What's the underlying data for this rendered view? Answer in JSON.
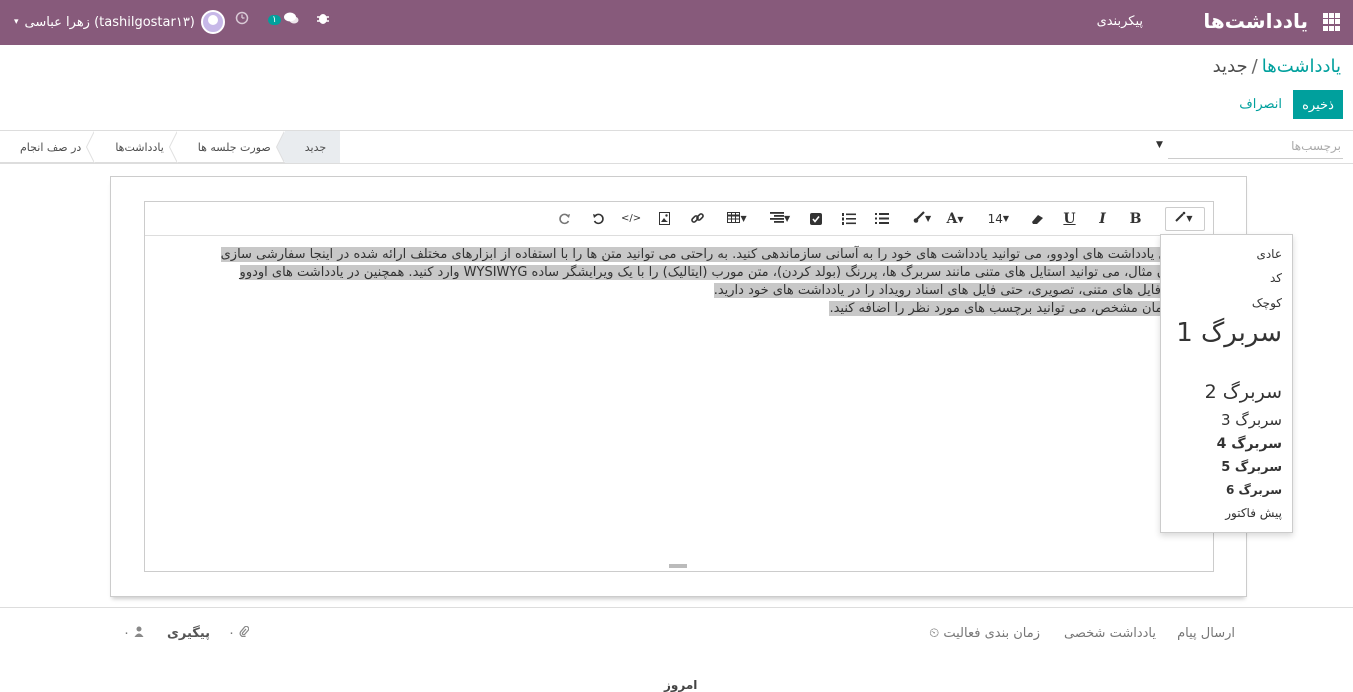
{
  "topbar": {
    "brand": "یادداشت‌ها",
    "menu_config": "پیکربندی",
    "user_name": "زهرا عباسی (tashilgostar۱۳)",
    "message_count": "۱",
    "caret": "▾",
    "icons": [
      "apps-grid-icon",
      "bug-icon",
      "chat-icon",
      "clock-icon",
      "avatar"
    ]
  },
  "breadcrumb": {
    "parent": "یادداشت‌ها",
    "separator": "/",
    "current": "جدید"
  },
  "actions": {
    "save": "ذخیره",
    "cancel": "انصراف"
  },
  "stages": [
    "جدید",
    "صورت جلسه ها",
    "یادداشت‌ها",
    "در صف انجام"
  ],
  "tags": {
    "placeholder": "برچسب‌ها"
  },
  "toolbar": {
    "font_size": "14",
    "font_color_label": "A",
    "bold": "B",
    "italic": "I",
    "underline": "U",
    "code_view": "</>"
  },
  "content": {
    "lines": [
      "با ماژول یادداشت های اودوو، می توانید یادداشت های خود را به آسانی سازماندهی کنید. به راحتی می توانید متن ها را با استفاده از ابزارهای مختلف ارائه شده در اینجا سفارشی سازی",
      "به عنوان مثال، می توانید استایل های متنی مانند سربرگ ها، پررنگ (بولد کردن)، متن مورب (ایتالیک) را با یک ویرایشگر ساده WYSIWYG وارد کنید. همچنین در یادداشت های اودوو",
      "پیوست فایل های متنی، تصویری، حتی فایل های اسناد رویداد را در یادداشت های خود دارید.",
      "یک سازمان مشخص، می توانید برچسب های مورد نظر را اضافه کنید."
    ]
  },
  "style_menu": {
    "normal": "عادی",
    "code": "کد",
    "small": "کوچک",
    "h1": "سربرگ 1",
    "h2": "سربرگ 2",
    "h3": "سربرگ 3",
    "h4": "سربرگ 4",
    "h5": "سربرگ 5",
    "h6": "سربرگ 6",
    "pre": "پیش فاکتور"
  },
  "chatter": {
    "send_message": "ارسال پیام",
    "log_note": "یادداشت شخصی",
    "schedule_activity": "زمان بندی فعالیت",
    "attachments_count": "۰",
    "follow": "پیگیری",
    "followers_count": "۰"
  },
  "footer_partial": "امروز"
}
